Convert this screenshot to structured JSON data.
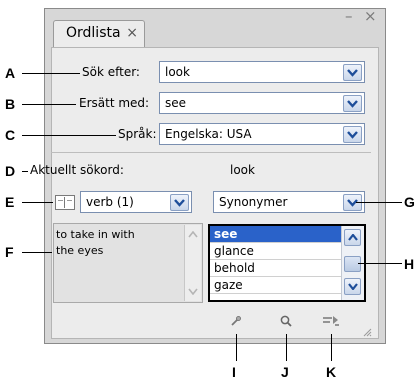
{
  "tab": {
    "title": "Ordlista",
    "close": "×"
  },
  "window": {
    "minimize": "–",
    "close": "×"
  },
  "callouts": {
    "A": "A",
    "B": "B",
    "C": "C",
    "D": "D",
    "E": "E",
    "F": "F",
    "G": "G",
    "H": "H",
    "I": "I",
    "J": "J",
    "K": "K"
  },
  "search": {
    "label": "Sök efter:",
    "value": "look"
  },
  "replace": {
    "label": "Ersätt med:",
    "value": "see"
  },
  "language": {
    "label": "Språk:",
    "value": "Engelska: USA"
  },
  "current": {
    "label": "Aktuellt sökord:",
    "value": "look"
  },
  "meaning": {
    "value": "verb (1)"
  },
  "definition": {
    "text_line1": "to take in with",
    "text_line2": "the eyes"
  },
  "relation": {
    "value": "Synonymer"
  },
  "results": {
    "items": [
      "see",
      "glance",
      "behold",
      "gaze"
    ],
    "selected_index": 0
  },
  "colors": {
    "selection": "#2a62c9",
    "panel": "#d7d7d7",
    "field_border": "#7a8fb0"
  }
}
